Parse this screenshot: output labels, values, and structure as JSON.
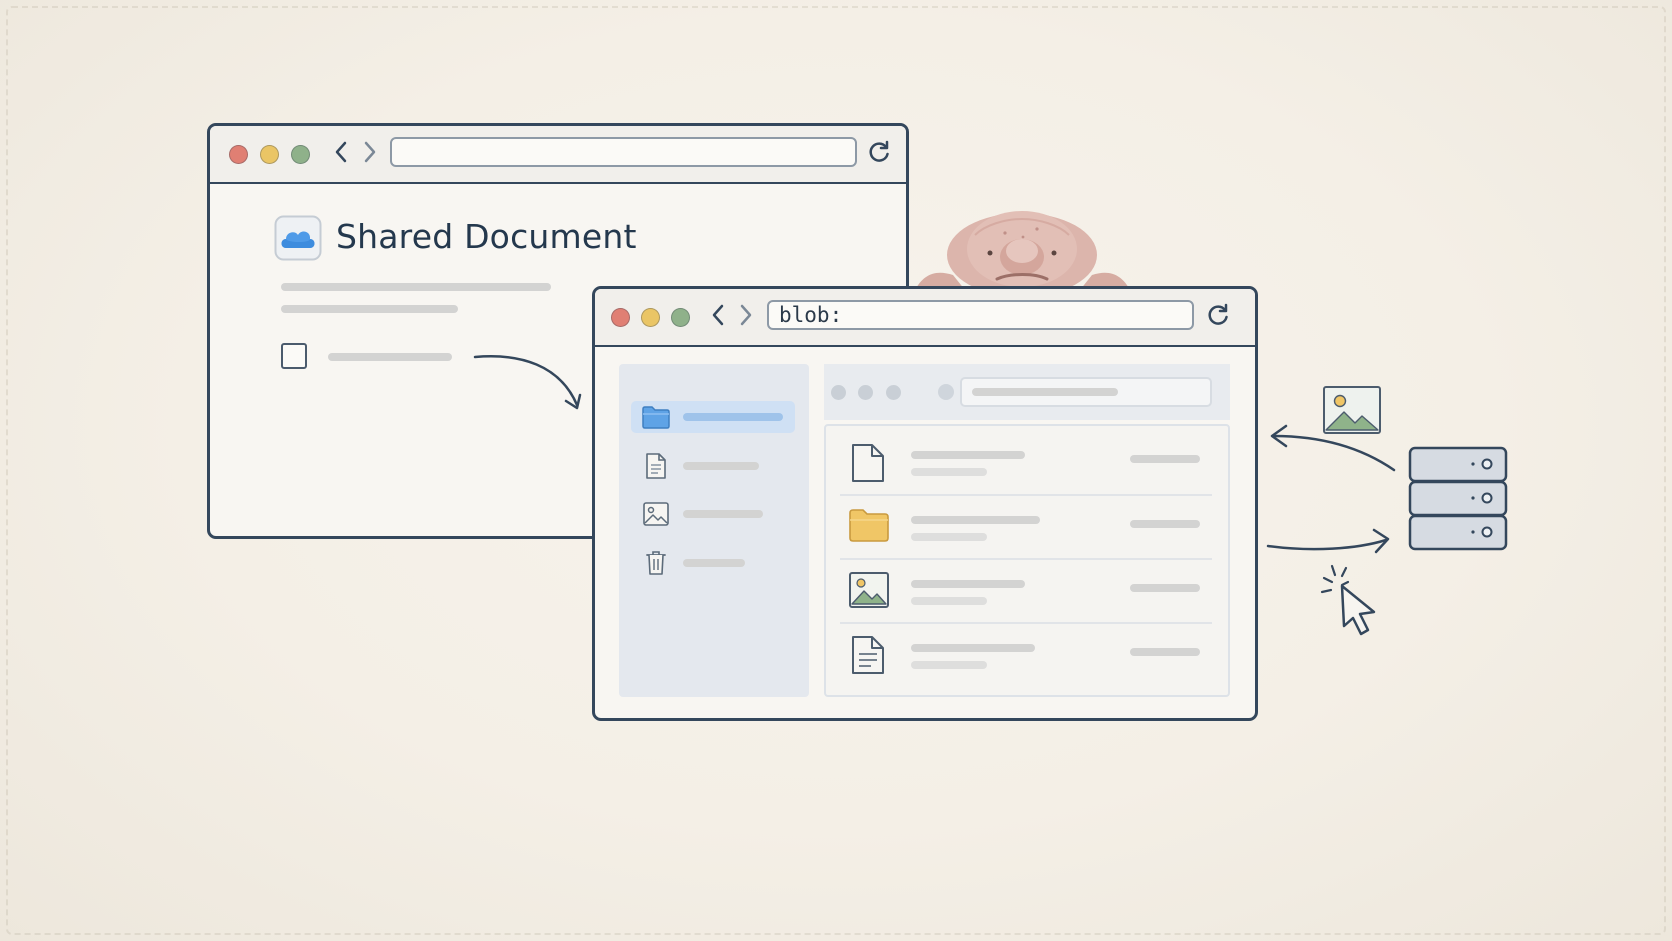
{
  "back_window": {
    "title": "Shared Document",
    "url": "",
    "icons": [
      "cloud-icon",
      "checkbox"
    ]
  },
  "front_window": {
    "url": "blob:",
    "sidebar_items": [
      {
        "icon": "folder-icon",
        "selected": true
      },
      {
        "icon": "document-icon",
        "selected": false
      },
      {
        "icon": "image-icon",
        "selected": false
      },
      {
        "icon": "trash-icon",
        "selected": false
      }
    ],
    "file_rows": [
      {
        "icon": "document-icon"
      },
      {
        "icon": "folder-icon"
      },
      {
        "icon": "image-icon"
      },
      {
        "icon": "document-icon"
      }
    ]
  },
  "colors": {
    "outline": "#34475c",
    "traffic_red": "#e07f73",
    "traffic_yellow": "#eac565",
    "traffic_green": "#8fb18a",
    "folder_blue": "#5fa3e6",
    "folder_yellow": "#f0c666",
    "selection": "#cfe0f4"
  },
  "decor": {
    "mascot": "blobfish-illustration",
    "server": "server-stack-icon",
    "cursor": "pointer-cursor-icon",
    "picture": "image-icon"
  }
}
